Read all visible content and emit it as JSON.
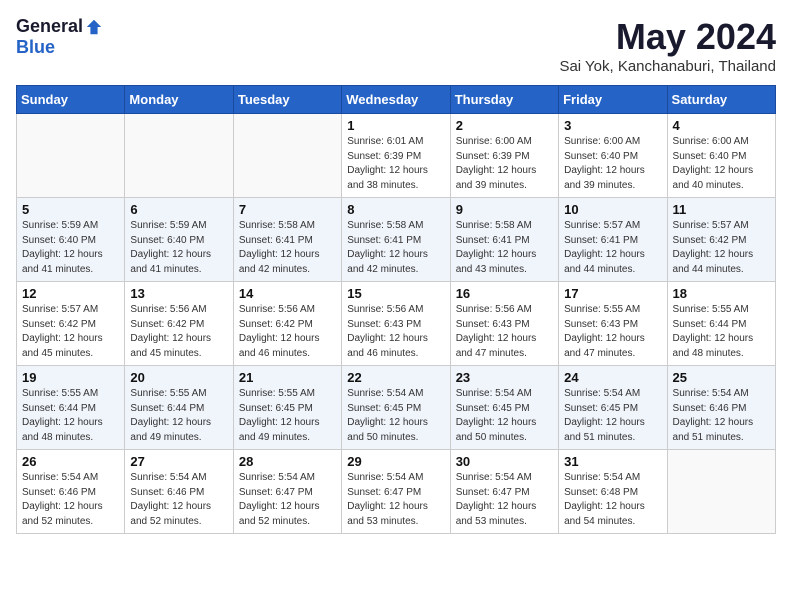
{
  "logo": {
    "general": "General",
    "blue": "Blue"
  },
  "header": {
    "title": "May 2024",
    "subtitle": "Sai Yok, Kanchanaburi, Thailand"
  },
  "weekdays": [
    "Sunday",
    "Monday",
    "Tuesday",
    "Wednesday",
    "Thursday",
    "Friday",
    "Saturday"
  ],
  "weeks": [
    [
      {
        "day": "",
        "info": ""
      },
      {
        "day": "",
        "info": ""
      },
      {
        "day": "",
        "info": ""
      },
      {
        "day": "1",
        "info": "Sunrise: 6:01 AM\nSunset: 6:39 PM\nDaylight: 12 hours and 38 minutes."
      },
      {
        "day": "2",
        "info": "Sunrise: 6:00 AM\nSunset: 6:39 PM\nDaylight: 12 hours and 39 minutes."
      },
      {
        "day": "3",
        "info": "Sunrise: 6:00 AM\nSunset: 6:40 PM\nDaylight: 12 hours and 39 minutes."
      },
      {
        "day": "4",
        "info": "Sunrise: 6:00 AM\nSunset: 6:40 PM\nDaylight: 12 hours and 40 minutes."
      }
    ],
    [
      {
        "day": "5",
        "info": "Sunrise: 5:59 AM\nSunset: 6:40 PM\nDaylight: 12 hours and 41 minutes."
      },
      {
        "day": "6",
        "info": "Sunrise: 5:59 AM\nSunset: 6:40 PM\nDaylight: 12 hours and 41 minutes."
      },
      {
        "day": "7",
        "info": "Sunrise: 5:58 AM\nSunset: 6:41 PM\nDaylight: 12 hours and 42 minutes."
      },
      {
        "day": "8",
        "info": "Sunrise: 5:58 AM\nSunset: 6:41 PM\nDaylight: 12 hours and 42 minutes."
      },
      {
        "day": "9",
        "info": "Sunrise: 5:58 AM\nSunset: 6:41 PM\nDaylight: 12 hours and 43 minutes."
      },
      {
        "day": "10",
        "info": "Sunrise: 5:57 AM\nSunset: 6:41 PM\nDaylight: 12 hours and 44 minutes."
      },
      {
        "day": "11",
        "info": "Sunrise: 5:57 AM\nSunset: 6:42 PM\nDaylight: 12 hours and 44 minutes."
      }
    ],
    [
      {
        "day": "12",
        "info": "Sunrise: 5:57 AM\nSunset: 6:42 PM\nDaylight: 12 hours and 45 minutes."
      },
      {
        "day": "13",
        "info": "Sunrise: 5:56 AM\nSunset: 6:42 PM\nDaylight: 12 hours and 45 minutes."
      },
      {
        "day": "14",
        "info": "Sunrise: 5:56 AM\nSunset: 6:42 PM\nDaylight: 12 hours and 46 minutes."
      },
      {
        "day": "15",
        "info": "Sunrise: 5:56 AM\nSunset: 6:43 PM\nDaylight: 12 hours and 46 minutes."
      },
      {
        "day": "16",
        "info": "Sunrise: 5:56 AM\nSunset: 6:43 PM\nDaylight: 12 hours and 47 minutes."
      },
      {
        "day": "17",
        "info": "Sunrise: 5:55 AM\nSunset: 6:43 PM\nDaylight: 12 hours and 47 minutes."
      },
      {
        "day": "18",
        "info": "Sunrise: 5:55 AM\nSunset: 6:44 PM\nDaylight: 12 hours and 48 minutes."
      }
    ],
    [
      {
        "day": "19",
        "info": "Sunrise: 5:55 AM\nSunset: 6:44 PM\nDaylight: 12 hours and 48 minutes."
      },
      {
        "day": "20",
        "info": "Sunrise: 5:55 AM\nSunset: 6:44 PM\nDaylight: 12 hours and 49 minutes."
      },
      {
        "day": "21",
        "info": "Sunrise: 5:55 AM\nSunset: 6:45 PM\nDaylight: 12 hours and 49 minutes."
      },
      {
        "day": "22",
        "info": "Sunrise: 5:54 AM\nSunset: 6:45 PM\nDaylight: 12 hours and 50 minutes."
      },
      {
        "day": "23",
        "info": "Sunrise: 5:54 AM\nSunset: 6:45 PM\nDaylight: 12 hours and 50 minutes."
      },
      {
        "day": "24",
        "info": "Sunrise: 5:54 AM\nSunset: 6:45 PM\nDaylight: 12 hours and 51 minutes."
      },
      {
        "day": "25",
        "info": "Sunrise: 5:54 AM\nSunset: 6:46 PM\nDaylight: 12 hours and 51 minutes."
      }
    ],
    [
      {
        "day": "26",
        "info": "Sunrise: 5:54 AM\nSunset: 6:46 PM\nDaylight: 12 hours and 52 minutes."
      },
      {
        "day": "27",
        "info": "Sunrise: 5:54 AM\nSunset: 6:46 PM\nDaylight: 12 hours and 52 minutes."
      },
      {
        "day": "28",
        "info": "Sunrise: 5:54 AM\nSunset: 6:47 PM\nDaylight: 12 hours and 52 minutes."
      },
      {
        "day": "29",
        "info": "Sunrise: 5:54 AM\nSunset: 6:47 PM\nDaylight: 12 hours and 53 minutes."
      },
      {
        "day": "30",
        "info": "Sunrise: 5:54 AM\nSunset: 6:47 PM\nDaylight: 12 hours and 53 minutes."
      },
      {
        "day": "31",
        "info": "Sunrise: 5:54 AM\nSunset: 6:48 PM\nDaylight: 12 hours and 54 minutes."
      },
      {
        "day": "",
        "info": ""
      }
    ]
  ]
}
